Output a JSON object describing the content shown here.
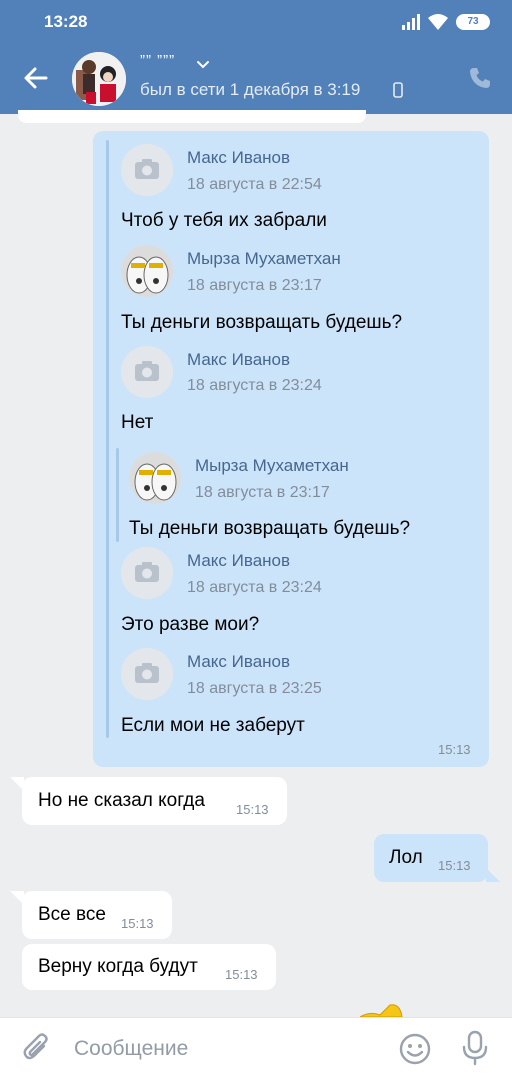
{
  "status_bar": {
    "time": "13:28",
    "battery": "73"
  },
  "header": {
    "chat_name": "”” ”””",
    "last_seen": "был в сети 1 декабря в 3:19"
  },
  "forwarded": {
    "items": [
      {
        "author": "Макс Иванов",
        "date": "18 августа в 22:54",
        "text": "Чтоб у тебя их забрали"
      },
      {
        "author": "Мырза Мухаметхан",
        "date": "18 августа в 23:17",
        "text": "Ты деньги возвращать будешь?"
      },
      {
        "author": "Макс Иванов",
        "date": "18 августа в 23:24",
        "text": "Нет"
      },
      {
        "author": "Мырза Мухаметхан",
        "date": "18 августа в 23:17",
        "text": "Ты деньги возвращать будешь?"
      },
      {
        "author": "Макс Иванов",
        "date": "18 августа в 23:24",
        "text": "Это разве мои?"
      },
      {
        "author": "Макс Иванов",
        "date": "18 августа в 23:25",
        "text": "Если мои не заберут"
      }
    ],
    "time": "15:13"
  },
  "messages": [
    {
      "text": "Но не сказал когда",
      "time": "15:13",
      "direction": "in"
    },
    {
      "text": "Лол",
      "time": "15:13",
      "direction": "out"
    },
    {
      "text": "Все все",
      "time": "15:13",
      "direction": "in"
    },
    {
      "text": "Верну когда будут",
      "time": "15:13",
      "direction": "in"
    }
  ],
  "composer": {
    "placeholder": "Сообщение"
  },
  "colors": {
    "header": "#5181b8",
    "outgoing": "#cce4fa",
    "background": "#edeef0",
    "author": "#45678f"
  }
}
